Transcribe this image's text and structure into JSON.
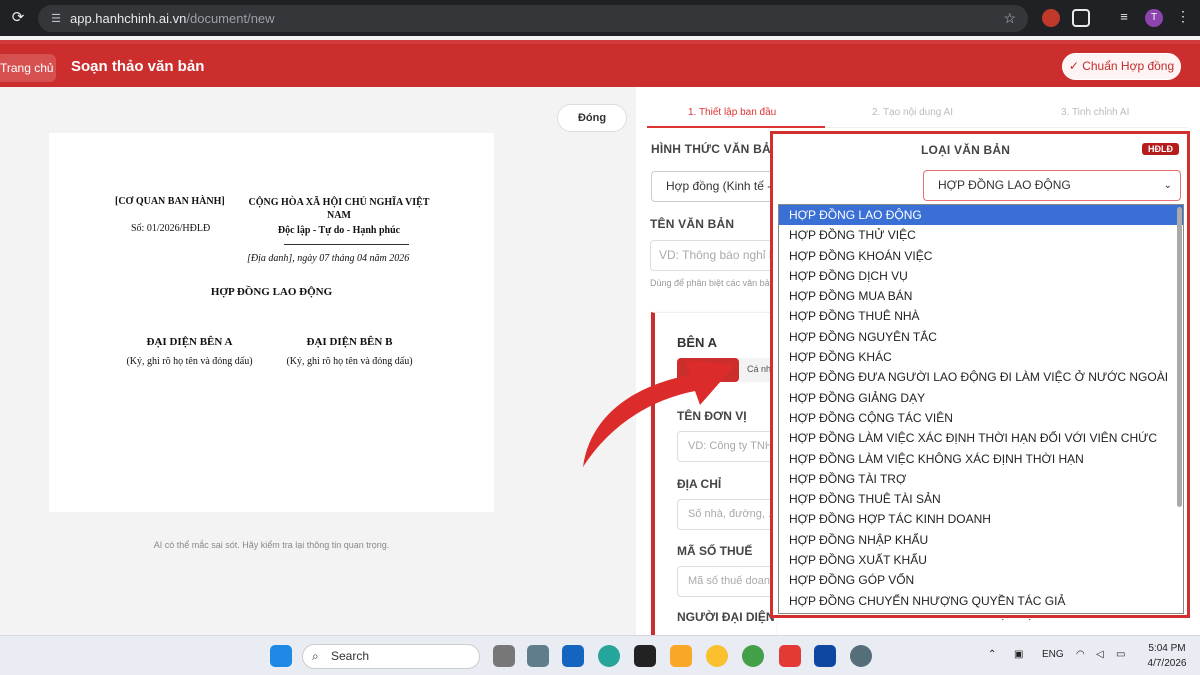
{
  "browser": {
    "url_host": "app.hanhchinh.ai.vn",
    "url_path": "/document/new",
    "profile_initial": "T"
  },
  "header": {
    "home_label": "Trang chủ",
    "title": "Soạn thảo văn bản",
    "standard_btn": "✓ Chuẩn Hợp đồng",
    "accent": "#cc2d2d"
  },
  "preview": {
    "close_label": "Đóng",
    "agency": "[CƠ QUAN BAN HÀNH]",
    "number": "Số: 01/2026/HĐLĐ",
    "nation": "CỘNG HÒA XÃ HỘI CHỦ NGHĨA VIỆT NAM",
    "motto": "Độc lập - Tự do - Hạnh phúc",
    "date": "[Địa danh], ngày 07 tháng 04 năm 2026",
    "doc_title": "HỢP ĐỒNG LAO ĐỘNG",
    "sign_a": "ĐẠI DIỆN BÊN A",
    "sign_b": "ĐẠI DIỆN BÊN B",
    "sign_note_a": "(Ký, ghi rõ họ tên và đóng dấu)",
    "sign_note_b": "(Ký, ghi rõ họ tên và đóng dấu)",
    "disclaimer": "AI có thể mắc sai sót. Hãy kiểm tra lại thông tin quan trọng."
  },
  "steps": [
    "1. Thiết lập ban đầu",
    "2. Tạo nội dung AI",
    "3. Tinh chỉnh AI"
  ],
  "form": {
    "format_label": "HÌNH THỨC VĂN BẢN",
    "format_value": "Hợp đồng (Kinh tế - Dân sự)",
    "type_label": "LOẠI VĂN BẢN",
    "type_badge": "HĐLĐ",
    "type_value": "HỢP ĐỒNG LAO ĐỘNG",
    "name_label": "TÊN VĂN BẢN",
    "name_placeholder": "VD: Thông báo nghỉ lễ",
    "name_hint": "Dùng để phân biệt các văn bản",
    "party_title": "BÊN A",
    "party_toggle": "Cá nhân",
    "unit_label": "TÊN ĐƠN VỊ",
    "unit_placeholder": "VD: Công ty TNHH",
    "address_label": "ĐỊA CHỈ",
    "address_placeholder": "Số nhà, đường, ...",
    "tax_label": "MÃ SỐ THUẾ",
    "tax_placeholder": "Mã số thuế doanh nghiệp",
    "rep_label": "NGƯỜI ĐẠI DIỆN",
    "rep_label_b": "NGƯỜI ĐẠI DIỆN"
  },
  "dropdown": [
    "HỢP ĐỒNG LAO ĐỘNG",
    "HỢP ĐỒNG THỬ VIỆC",
    "HỢP ĐỒNG KHOÁN VIỆC",
    "HỢP ĐỒNG DỊCH VỤ",
    "HỢP ĐỒNG MUA BÁN",
    "HỢP ĐỒNG THUÊ NHÀ",
    "HỢP ĐỒNG NGUYÊN TẮC",
    "HỢP ĐỒNG KHÁC",
    "HỢP ĐỒNG ĐƯA NGƯỜI LAO ĐỘNG ĐI LÀM VIỆC Ở NƯỚC NGOÀI",
    "HỢP ĐỒNG GIẢNG DẠY",
    "HỢP ĐỒNG CỘNG TÁC VIÊN",
    "HỢP ĐỒNG LÀM VIỆC XÁC ĐỊNH THỜI HẠN ĐỐI VỚI VIÊN CHỨC",
    "HỢP ĐỒNG LÀM VIỆC KHÔNG XÁC ĐỊNH THỜI HẠN",
    "HỢP ĐỒNG TÀI TRỢ",
    "HỢP ĐỒNG THUÊ TÀI SẢN",
    "HỢP ĐỒNG HỢP TÁC KINH DOANH",
    "HỢP ĐỒNG NHẬP KHẨU",
    "HỢP ĐỒNG XUẤT KHẨU",
    "HỢP ĐỒNG GÓP VỐN",
    "HỢP ĐỒNG CHUYỂN NHƯỢNG QUYỀN TÁC GIẢ"
  ],
  "taskbar": {
    "search": "Search",
    "lang": "ENG",
    "time": "5:04 PM",
    "date": "4/7/2026"
  }
}
